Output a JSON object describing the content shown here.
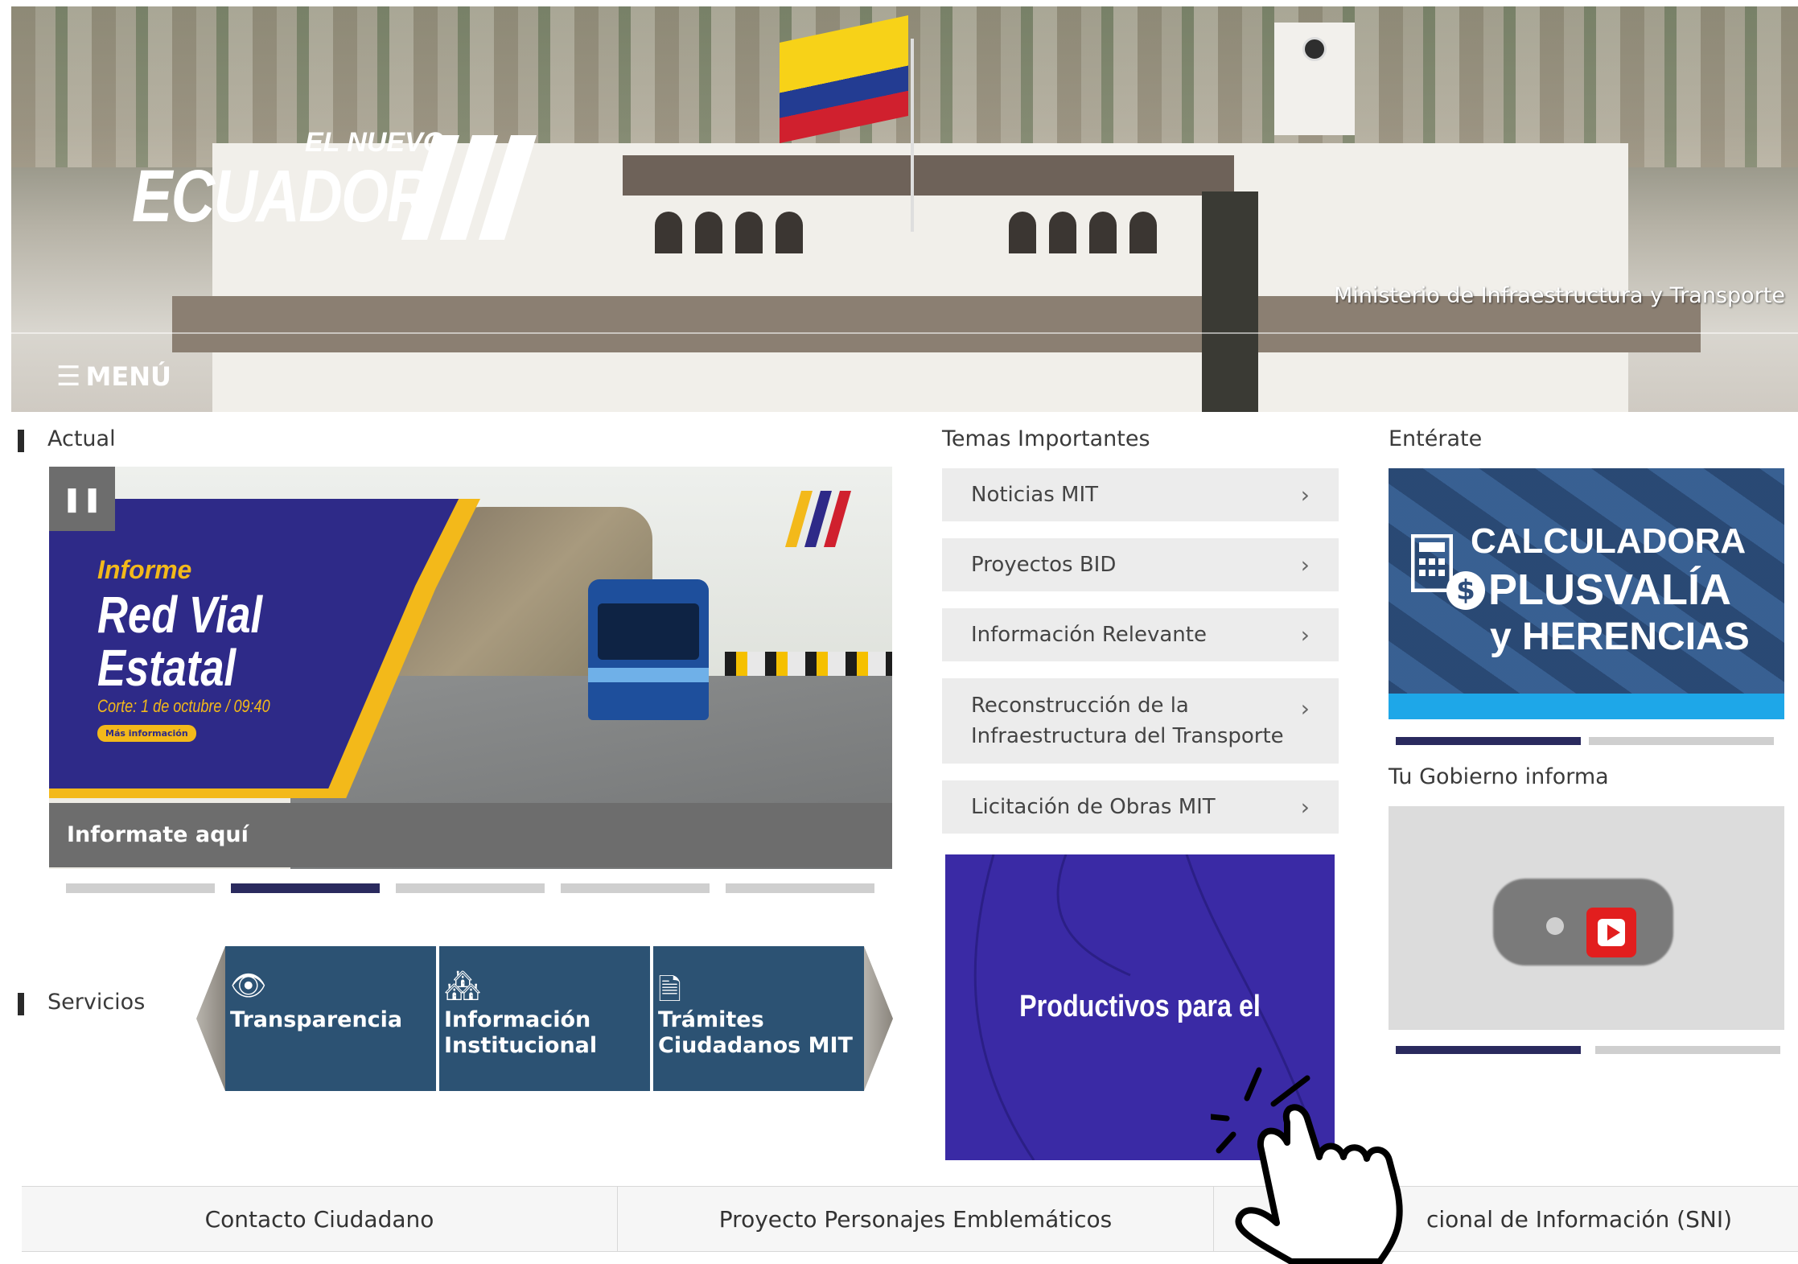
{
  "header": {
    "logo_small": "EL NUEVO",
    "logo_big": "ECUADOR",
    "ministry": "Ministerio de Infraestructura y Transporte",
    "menu_label": "MENÚ"
  },
  "actual": {
    "title": "Actual",
    "pause_icon": "pause-icon",
    "slide": {
      "informe": "Informe",
      "headline_line1": "Red Vial",
      "headline_line2": "Estatal",
      "corte": "Corte: 1 de octubre / 09:40",
      "mas_info": "Más información",
      "caption": "Informate aquí"
    },
    "dots_count": 5,
    "active_dot": 1
  },
  "temas": {
    "title": "Temas Importantes",
    "items": [
      {
        "label": "Noticias MIT"
      },
      {
        "label": "Proyectos BID"
      },
      {
        "label": "Información Relevante"
      },
      {
        "label_line1": "Reconstrucción de la",
        "label_line2": "Infraestructura del Transporte"
      },
      {
        "label": "Licitación de Obras MIT"
      }
    ],
    "promo_text": "Productivos para el"
  },
  "enterate": {
    "title": "Entérate",
    "calc_line1": "CALCULADORA",
    "calc_line2": "PLUSVALÍA",
    "calc_line3": "y HERENCIAS",
    "gobierno_title": "Tu Gobierno informa"
  },
  "servicios": {
    "title": "Servicios",
    "items": [
      {
        "icon": "eye-icon",
        "label_line1": "Transparencia",
        "label_line2": ""
      },
      {
        "icon": "buildings-icon",
        "label_line1": "Información",
        "label_line2": "Institucional"
      },
      {
        "icon": "document-icon",
        "label_line1": "Trámites",
        "label_line2": "Ciudadanos MIT"
      }
    ]
  },
  "footer": {
    "tabs": [
      "Contacto Ciudadano",
      "Proyecto Personajes Emblemáticos",
      "cional de Información (SNI)"
    ]
  },
  "colors": {
    "service_tile": "#2c5273",
    "promo_bg": "#3a2aa5",
    "active_dot": "#2a2a5e",
    "panel_blue": "#2e2a88",
    "accent_yellow": "#f3b91a"
  }
}
